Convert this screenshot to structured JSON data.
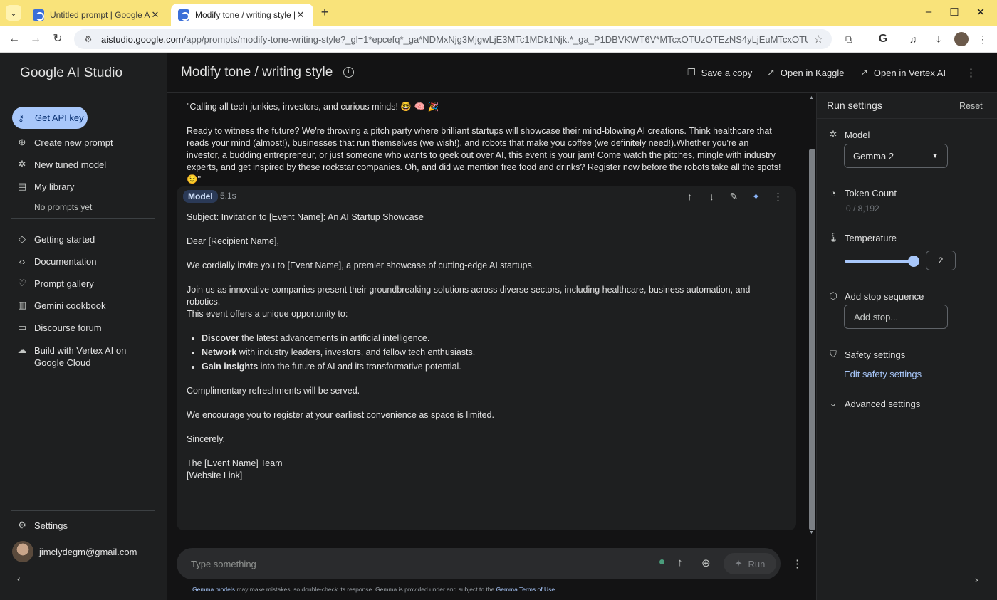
{
  "browser": {
    "tabs": [
      {
        "title": "Untitled prompt | Google AI Studio"
      },
      {
        "title": "Modify tone / writing style | Google AI Studio"
      }
    ],
    "url_host": "aistudio.google.com",
    "url_path": "/app/prompts/modify-tone-writing-style?_gl=1*epcefq*_ga*NDMxNjg3MjgwLjE3MTc1MDk1Njk.*_ga_P1DBVKWT6V*MTcxOTUzOTEzNS4yLjEuMTcxOTU0MDQ2NS4xMS..."
  },
  "sidebar": {
    "brand": "Google AI Studio",
    "api_key_label": "Get API key",
    "items": [
      {
        "label": "Create new prompt"
      },
      {
        "label": "New tuned model"
      },
      {
        "label": "My library"
      },
      {
        "label": "Getting started"
      },
      {
        "label": "Documentation"
      },
      {
        "label": "Prompt gallery"
      },
      {
        "label": "Gemini cookbook"
      },
      {
        "label": "Discourse forum"
      },
      {
        "label": "Build with Vertex AI on Google Cloud"
      }
    ],
    "library_empty": "No prompts yet",
    "settings_label": "Settings",
    "user_email": "jimclydegm@gmail.com"
  },
  "header": {
    "title": "Modify tone / writing style",
    "save_copy": "Save a copy",
    "open_kaggle": "Open in Kaggle",
    "open_vertex": "Open in Vertex AI"
  },
  "chat": {
    "user_message": [
      "\"Calling all tech junkies, investors, and curious minds! 🤓 🧠 🎉",
      "Ready to witness the future? We're throwing a pitch party where brilliant startups will showcase their mind-blowing AI creations. Think healthcare that reads your mind (almost!), businesses that run themselves (we wish!), and robots that make you coffee (we definitely need!).Whether you're an investor, a budding entrepreneur, or just someone who wants to geek out over AI, this event is your jam! Come watch the pitches, mingle with industry experts, and get inspired by these rockstar companies. Oh, and did we mention free food and drinks? Register now before the robots take all the spots! 😉\""
    ],
    "model_label": "Model",
    "model_time": "5.1s",
    "model_response": {
      "subject": "Subject: Invitation to [Event Name]: An AI Startup Showcase",
      "greeting": "Dear [Recipient Name],",
      "p1": "We cordially invite you to [Event Name], a premier showcase of cutting-edge AI startups.",
      "p2a": "Join us as innovative companies present their groundbreaking solutions across diverse sectors, including healthcare, business automation, and robotics.",
      "p2b": "This event offers a unique opportunity to:",
      "bullets": [
        {
          "bold": "Discover",
          "rest": " the latest advancements in artificial intelligence."
        },
        {
          "bold": "Network",
          "rest": " with industry leaders, investors, and fellow tech enthusiasts."
        },
        {
          "bold": "Gain insights",
          "rest": " into the future of AI and its transformative potential."
        }
      ],
      "p3": "Complimentary refreshments will be served.",
      "p4": "We encourage you to register at your earliest convenience as space is limited.",
      "closing": "Sincerely,",
      "sign1": "The [Event Name] Team",
      "sign2": "[Website Link]"
    }
  },
  "composer": {
    "placeholder": "Type something",
    "run_label": "Run"
  },
  "footnote": {
    "link1": "Gemma models",
    "text": " may make mistakes, so double-check its response. Gemma is provided under and subject to the ",
    "link2": "Gemma Terms of Use"
  },
  "run_settings": {
    "title": "Run settings",
    "reset": "Reset",
    "model_label": "Model",
    "model_value": "Gemma 2",
    "token_label": "Token Count",
    "token_value": "0 / 8,192",
    "temperature_label": "Temperature",
    "temperature_value": "2",
    "temperature_fraction": 1.0,
    "stop_label": "Add stop sequence",
    "stop_placeholder": "Add stop...",
    "safety_label": "Safety settings",
    "safety_link": "Edit safety settings",
    "advanced_label": "Advanced settings"
  },
  "colors": {
    "accent": "#a8c7fa",
    "browser_frame": "#f9e37a",
    "background": "#131314",
    "panel": "#1e1f20"
  }
}
